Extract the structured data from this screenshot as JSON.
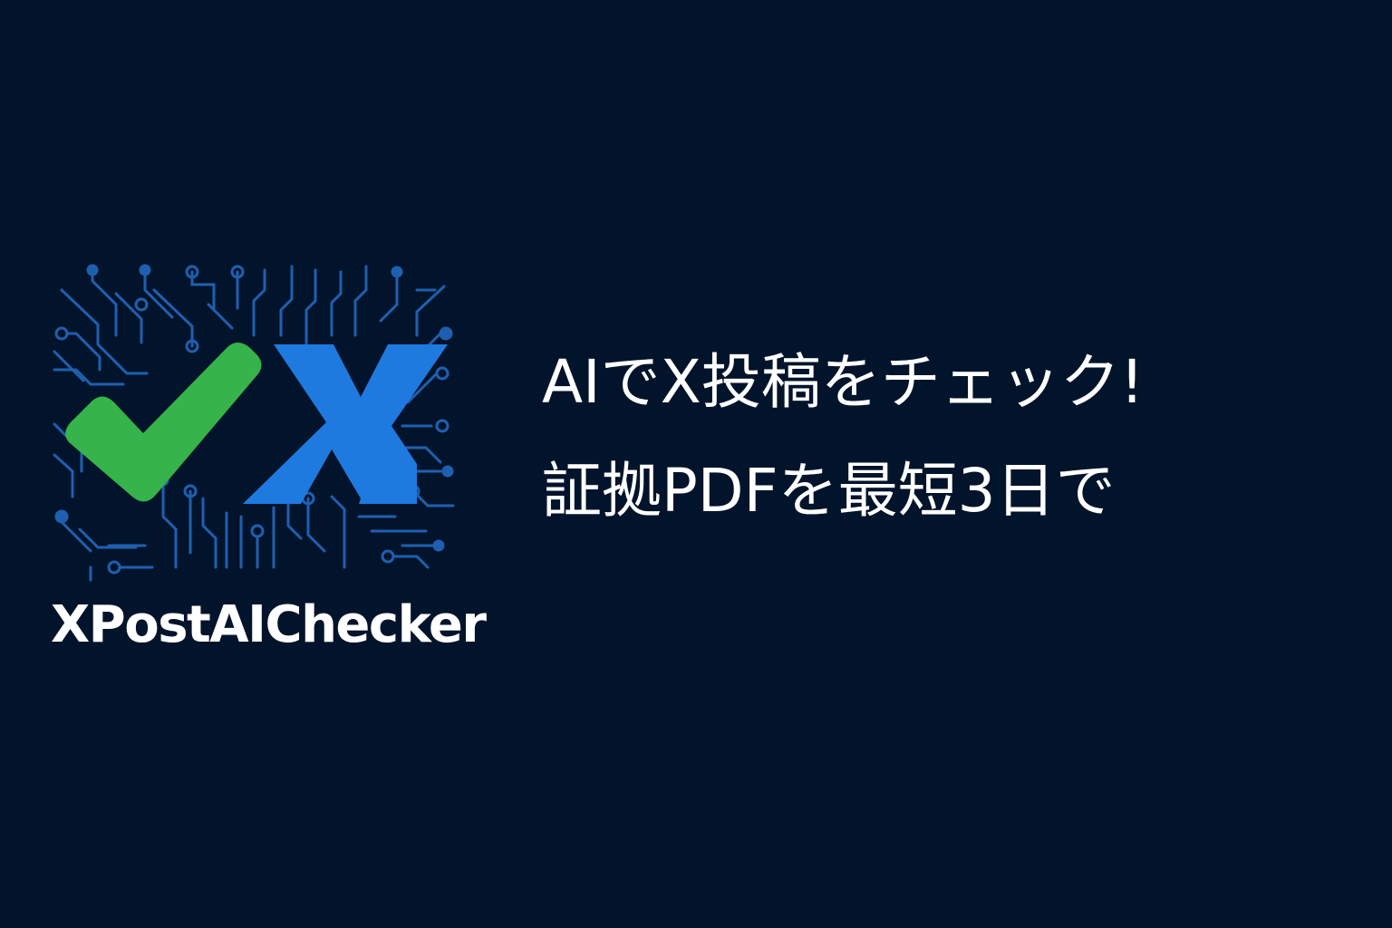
{
  "brand": {
    "name": "XPostAIChecker",
    "logo_icons": [
      "check-mark-icon",
      "x-letter-icon",
      "circuit-traces-icon"
    ]
  },
  "tagline": {
    "line1": "AIでX投稿をチェック!",
    "line2": "証拠PDFを最短3日で"
  },
  "colors": {
    "background": "#02142b",
    "check_green": "#3bb54a",
    "x_blue": "#1e7be0",
    "circuit_blue": "#1f5fb0",
    "text": "#ffffff"
  }
}
